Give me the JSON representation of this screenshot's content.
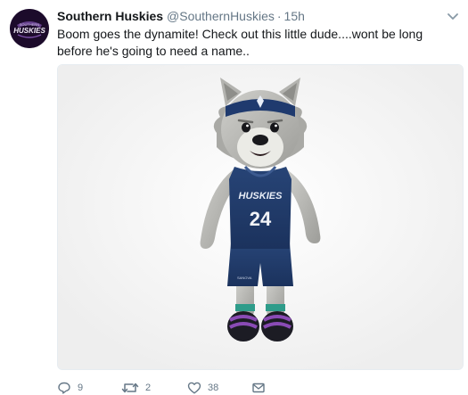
{
  "tweet": {
    "display_name": "Southern Huskies",
    "handle": "@SouthernHuskies",
    "separator": "·",
    "time": "15h",
    "text": "Boom goes the dynamite! Check out this little dude....wont be long before he's going to need a name..",
    "avatar": {
      "logo_text": "HUSKIES",
      "logo_subtext": "SOUTHERN",
      "logo_color": "#e6e0f0",
      "background": "#1c0b2b"
    },
    "media": {
      "jersey_text": "HUSKIES",
      "jersey_number": "24",
      "jersey_sponsor": "SANOVA",
      "jersey_color": "#213a6b",
      "fur_color": "#b9b9b5",
      "shoe_color": "#7a3fa0"
    },
    "actions": {
      "reply_count": "9",
      "retweet_count": "2",
      "like_count": "38",
      "reply_icon": "reply-icon",
      "retweet_icon": "retweet-icon",
      "like_icon": "heart-icon",
      "message_icon": "direct-message-icon"
    }
  },
  "colors": {
    "text": "#14171a",
    "muted": "#657786",
    "border": "#e6ecf0"
  }
}
